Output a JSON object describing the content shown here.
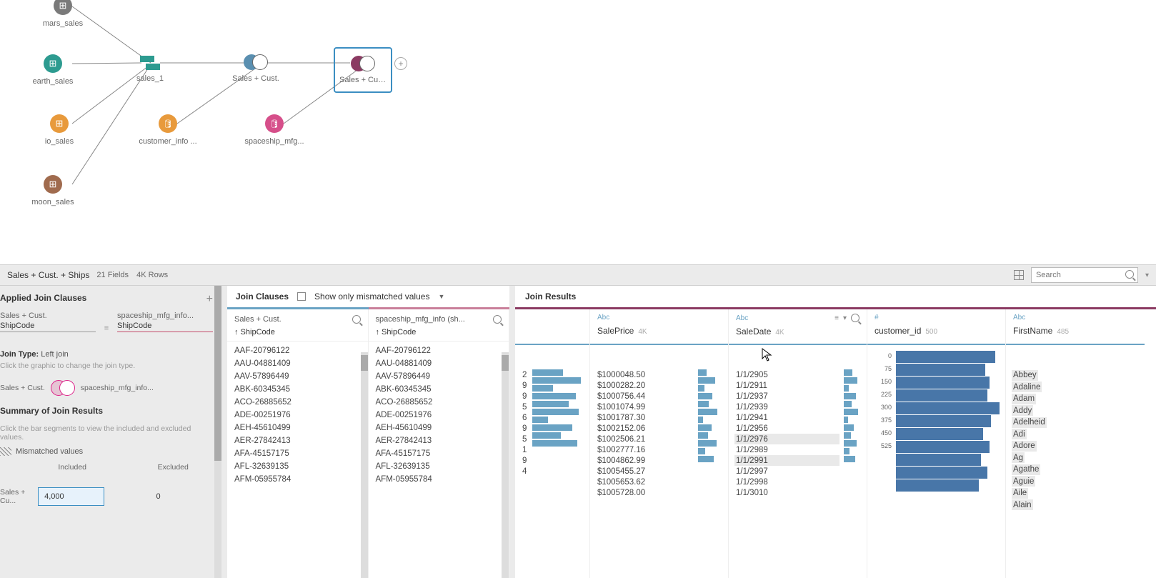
{
  "flow": {
    "nodes": {
      "mars": {
        "label": "mars_sales",
        "color": "#7a7a7a"
      },
      "earth": {
        "label": "earth_sales",
        "color": "#2d9b90"
      },
      "io": {
        "label": "io_sales",
        "color": "#e89a3c"
      },
      "moon": {
        "label": "moon_sales",
        "color": "#a06b4e"
      },
      "sales1": {
        "label": "sales_1"
      },
      "cust": {
        "label": "customer_info ...",
        "color": "#e89a3c"
      },
      "join1": {
        "label": "Sales + Cust."
      },
      "mfg": {
        "label": "spaceship_mfg...",
        "color": "#d64f8a"
      },
      "join2": {
        "label": "Sales + Cust. + ..."
      }
    }
  },
  "status": {
    "title": "Sales + Cust. + Ships",
    "fields": "21 Fields",
    "rows": "4K Rows",
    "search_placeholder": "Search"
  },
  "left": {
    "applied_title": "Applied Join Clauses",
    "src_a": "Sales + Cust.",
    "src_b": "spaceship_mfg_info...",
    "field_a": "ShipCode",
    "field_b": "ShipCode",
    "jointype_label": "Join Type:",
    "jointype_value": "Left join",
    "jointype_hint": "Click the graphic to change the join type.",
    "venn_a": "Sales + Cust.",
    "venn_b": "spaceship_mfg_info...",
    "summary_title": "Summary of Join Results",
    "summary_hint": "Click the bar segments to view the included and excluded values.",
    "mismatch_label": "Mismatched values",
    "col_included": "Included",
    "col_excluded": "Excluded",
    "row1_label": "Sales + Cu...",
    "row1_inc": "4,000",
    "row1_exc": "0"
  },
  "mid": {
    "title": "Join Clauses",
    "mismatch_chk": "Show only mismatched values",
    "col_a_src": "Sales + Cust.",
    "col_a_field": "↑ ShipCode",
    "col_b_src": "spaceship_mfg_info (sh...",
    "col_b_field": "↑ ShipCode",
    "items": [
      "AAF-20796122",
      "AAU-04881409",
      "AAV-57896449",
      "ABK-60345345",
      "ACO-26885652",
      "ADE-00251976",
      "AEH-45610499",
      "AER-27842413",
      "AFA-45157175",
      "AFL-32639135",
      "AFM-05955784"
    ]
  },
  "right": {
    "title": "Join Results",
    "cols": {
      "slice": {
        "ticks": [
          "2",
          "9",
          "9",
          "5",
          "6",
          "9",
          "5",
          "1",
          "9",
          "4"
        ]
      },
      "saleprice": {
        "type": "Abc",
        "name": "SalePrice",
        "count": "4K",
        "values": [
          "$1000048.50",
          "$1000282.20",
          "$1000756.44",
          "$1001074.99",
          "$1001787.30",
          "$1002152.06",
          "$1002506.21",
          "$1002777.16",
          "$1004862.99",
          "$1005455.27",
          "$1005653.62",
          "$1005728.00"
        ]
      },
      "saledate": {
        "type": "Abc",
        "name": "SaleDate",
        "count": "4K",
        "values": [
          "1/1/2905",
          "1/1/2911",
          "1/1/2937",
          "1/1/2939",
          "1/1/2941",
          "1/1/2956",
          "1/1/2976",
          "1/1/2989",
          "1/1/2991",
          "1/1/2997",
          "1/1/2998",
          "1/1/3010"
        ],
        "hl": [
          6,
          8
        ]
      },
      "customerid": {
        "type": "#",
        "name": "customer_id",
        "count": "500",
        "ticks": [
          "0",
          "75",
          "150",
          "225",
          "300",
          "375",
          "450",
          "525"
        ],
        "bars": [
          96,
          86,
          90,
          88,
          100,
          92,
          84,
          90,
          82,
          88,
          80
        ]
      },
      "firstname": {
        "type": "Abc",
        "name": "FirstName",
        "count": "485",
        "values": [
          "Abbey",
          "Adaline",
          "Adam",
          "Addy",
          "Adelheid",
          "Adi",
          "Adore",
          "Ag",
          "Agathe",
          "Aguie",
          "Aile",
          "Alain"
        ]
      }
    }
  }
}
